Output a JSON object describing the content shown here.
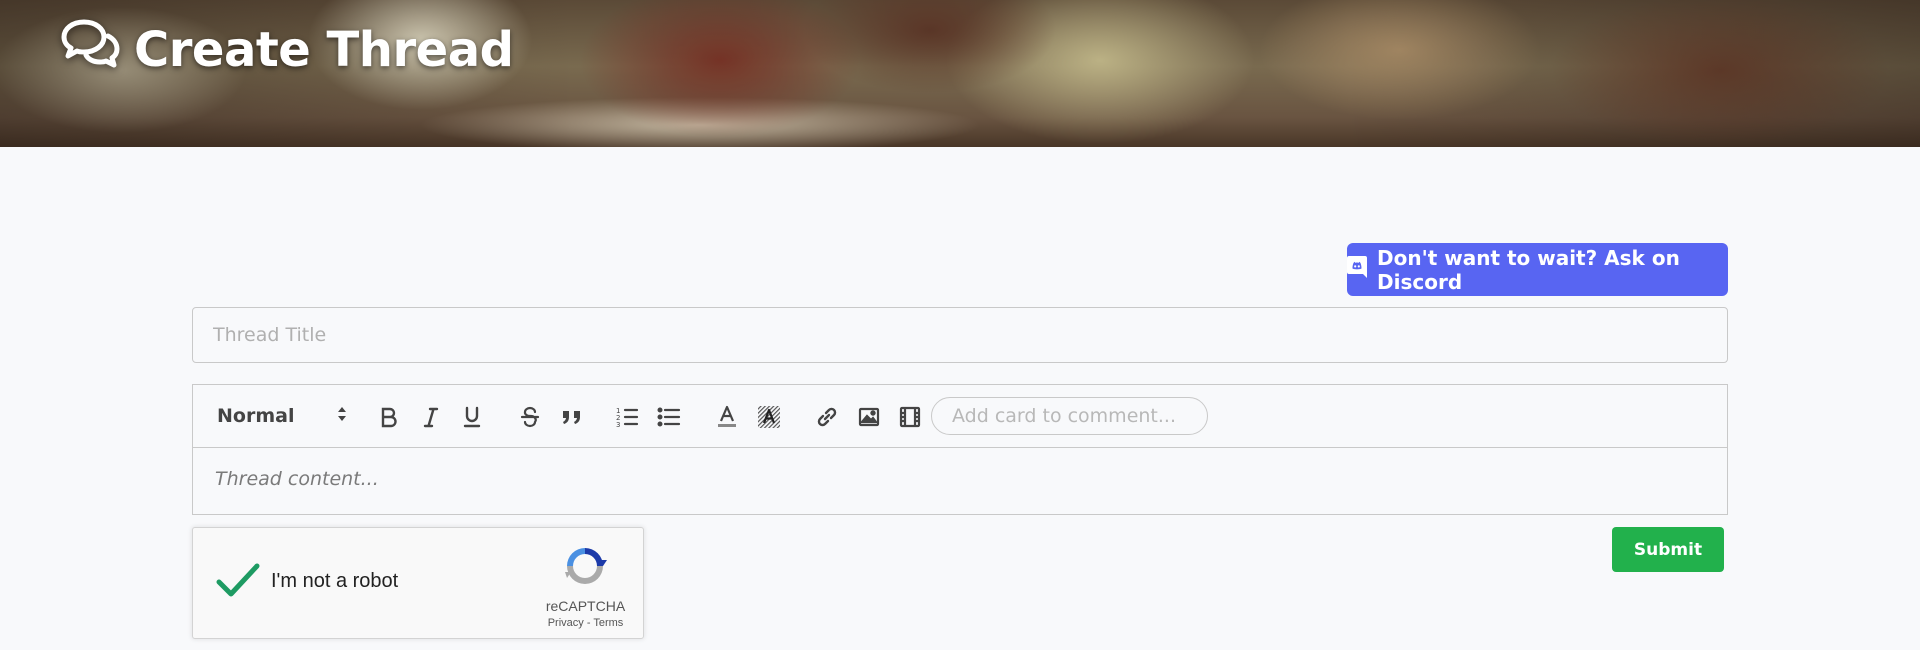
{
  "header": {
    "title": "Create Thread",
    "icon": "comments-icon"
  },
  "discord_button": {
    "label": "Don't want to wait? Ask on Discord",
    "icon": "discord-icon",
    "color": "#5865f2"
  },
  "form": {
    "title_placeholder": "Thread Title",
    "content_placeholder": "Thread content..."
  },
  "toolbar": {
    "header_select_value": "Normal",
    "buttons": [
      "bold",
      "italic",
      "underline",
      "strikethrough",
      "blockquote",
      "ordered-list",
      "bullet-list",
      "text-color",
      "background-color",
      "link",
      "image",
      "video"
    ],
    "card_input_placeholder": "Add card to comment..."
  },
  "recaptcha": {
    "label": "I'm not a robot",
    "brand": "reCAPTCHA",
    "privacy": "Privacy",
    "separator": " - ",
    "terms": "Terms",
    "checked": true
  },
  "submit": {
    "label": "Submit",
    "color": "#22b14c"
  }
}
